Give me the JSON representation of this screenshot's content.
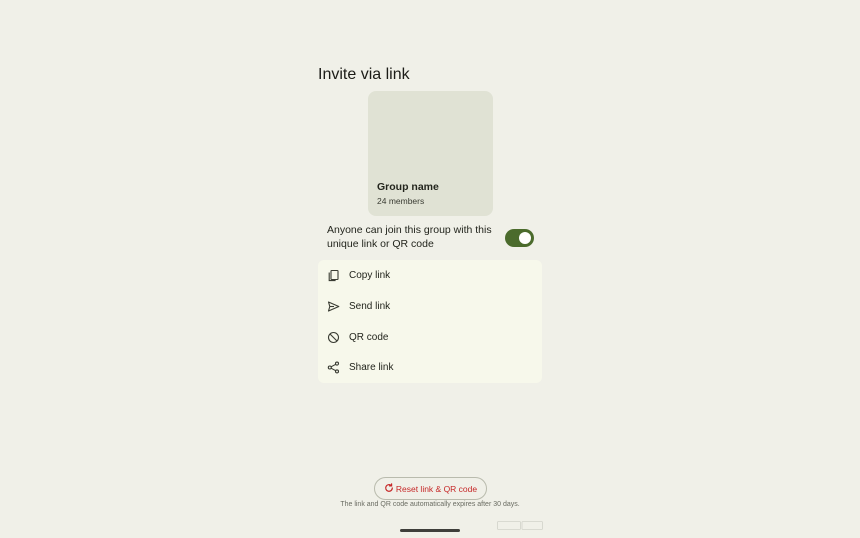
{
  "header": {
    "title": "Invite via link"
  },
  "group": {
    "name": "Group name",
    "members": "24 members"
  },
  "join": {
    "text": "Anyone can join this group with this unique link or QR code",
    "toggle_on": true,
    "toggle_color": "#4b6b2c"
  },
  "options": [
    {
      "label": "Copy link",
      "icon": "copy-icon"
    },
    {
      "label": "Send link",
      "icon": "send-icon"
    },
    {
      "label": "QR code",
      "icon": "block-icon"
    },
    {
      "label": "Share link",
      "icon": "share-icon"
    }
  ],
  "reset": {
    "label": "Reset link & QR code",
    "icon": "refresh-icon",
    "color": "#c62828"
  },
  "footnote": "The link and QR code automatically expires after 30 days."
}
